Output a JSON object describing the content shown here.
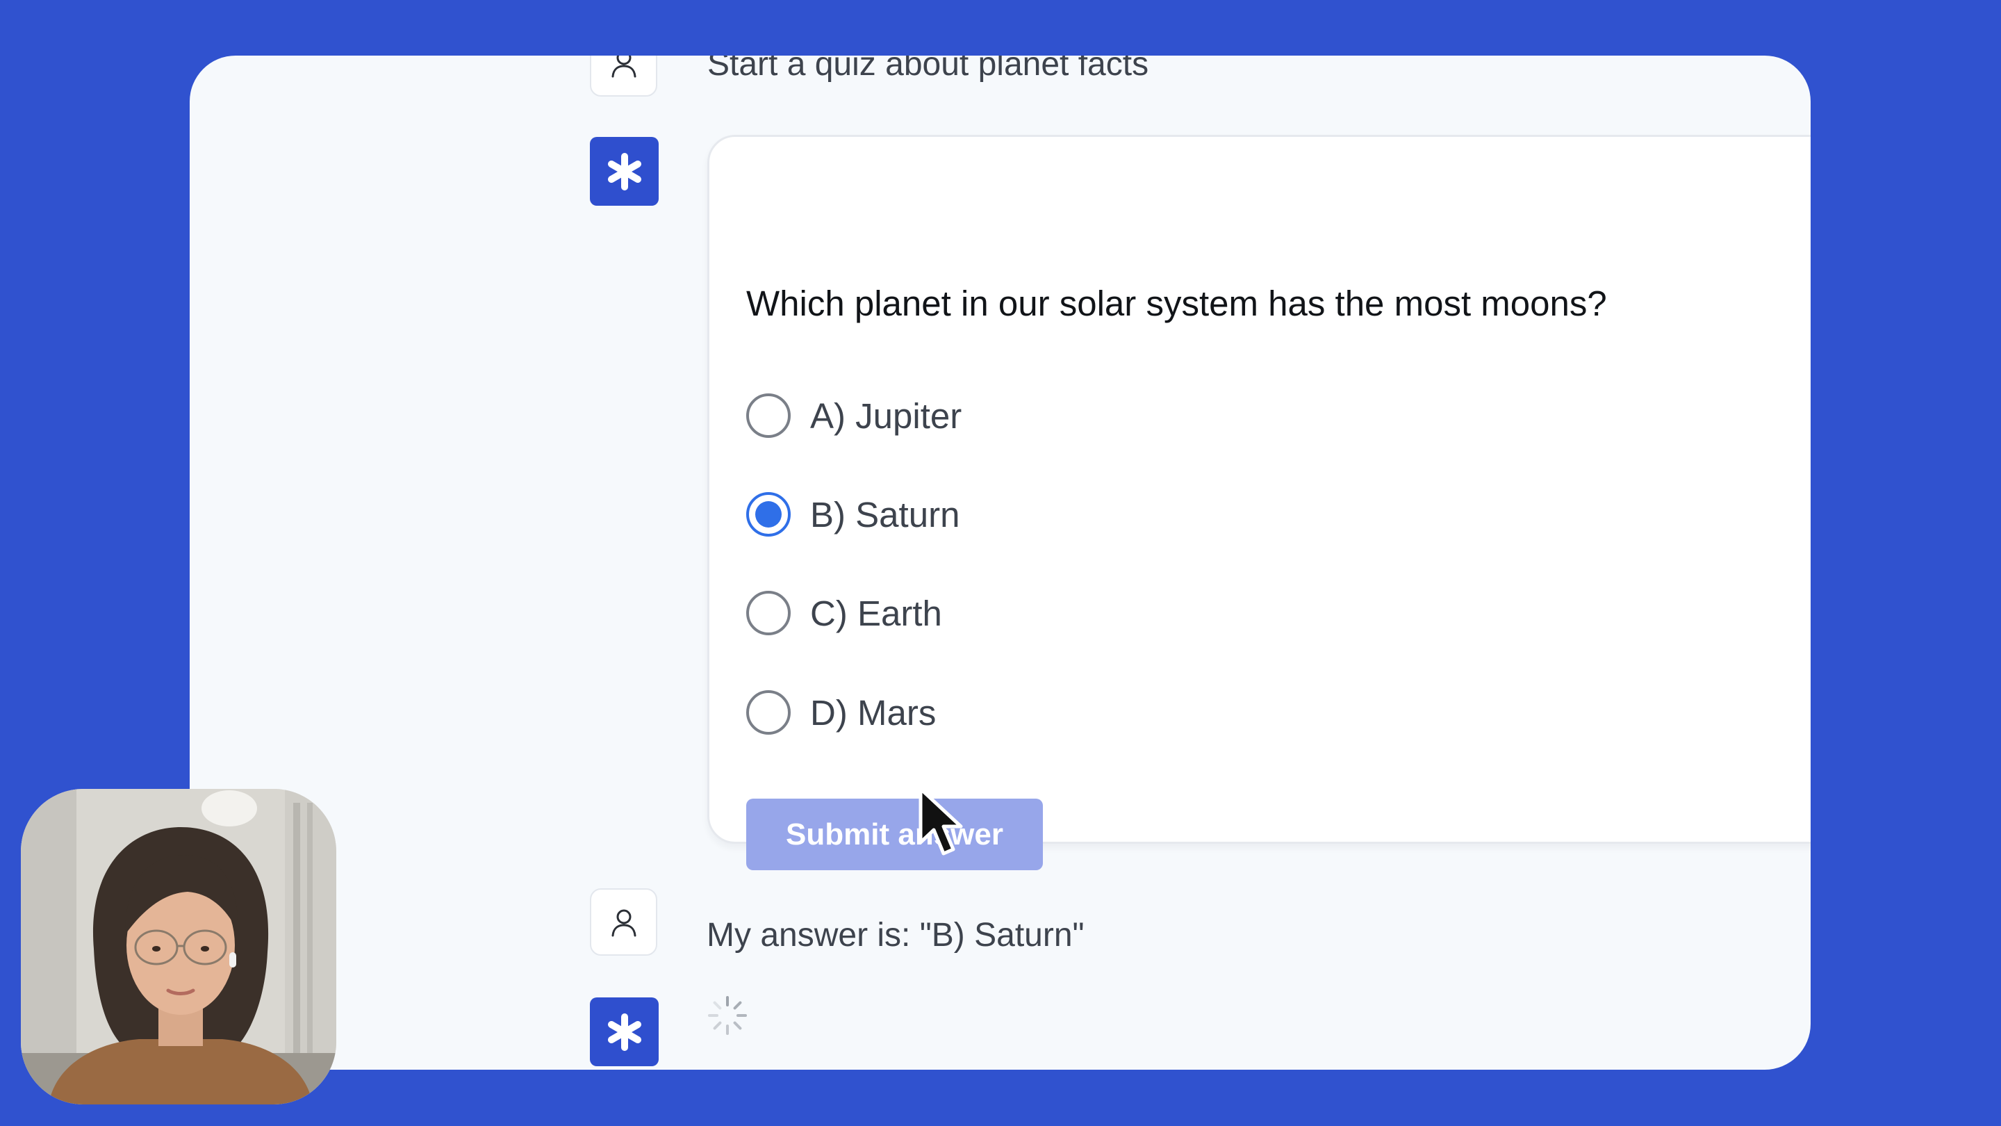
{
  "chat": {
    "user_prompt": "Start a quiz about planet facts",
    "user_reply": "My answer is: \"B) Saturn\""
  },
  "quiz": {
    "question": "Which planet in our solar system has the most moons?",
    "options": [
      {
        "label": "A) Jupiter",
        "selected": false
      },
      {
        "label": "B) Saturn",
        "selected": true
      },
      {
        "label": "C) Earth",
        "selected": false
      },
      {
        "label": "D) Mars",
        "selected": false
      }
    ],
    "submit_label": "Submit answer"
  },
  "icons": {
    "user_avatar": "person-icon",
    "assistant_avatar": "asterisk-icon",
    "loading": "spinner-icon",
    "pointer": "mouse-cursor-icon"
  },
  "colors": {
    "background": "#3052cf",
    "window": "#f6f9fc",
    "assistant_accent": "#2f4fce",
    "radio_selected": "#2f6fe8",
    "submit_button": "#97a6ea"
  }
}
